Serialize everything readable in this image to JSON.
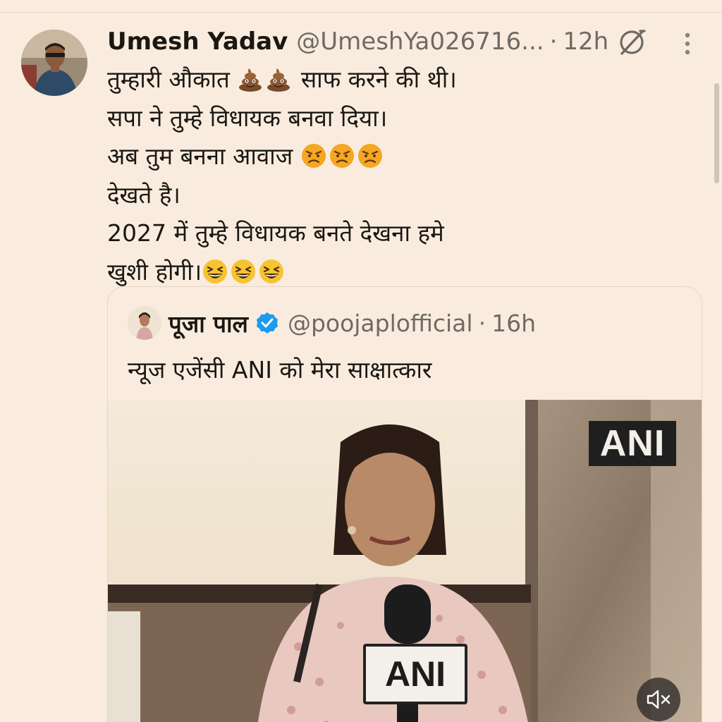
{
  "post": {
    "author_name": "Umesh Yadav",
    "author_handle": "@UmeshYa026716...",
    "separator": "·",
    "time": "12h",
    "lines": [
      {
        "text": "तुम्हारी औकात ",
        "emoji_before": [],
        "emoji_after": [
          "pile-of-poo",
          "pile-of-poo"
        ],
        "suffix": " साफ करने की थी।"
      },
      {
        "text": "सपा ने तुम्हे विधायक बनवा दिया।",
        "emoji_after": [],
        "suffix": ""
      },
      {
        "text": "अब तुम बनना आवाज ",
        "emoji_after": [
          "angry-face",
          "angry-face",
          "angry-face"
        ],
        "suffix": ""
      },
      {
        "text": "देखते है।",
        "emoji_after": [],
        "suffix": ""
      },
      {
        "text": "2027 में तुम्हे विधायक बनते देखना हमे",
        "emoji_after": [],
        "suffix": ""
      },
      {
        "text": "खुशी होगी।",
        "emoji_after": [
          "grinning-squinting-face",
          "grinning-squinting-face",
          "grinning-squinting-face"
        ],
        "suffix": ""
      }
    ]
  },
  "quote": {
    "author_name": "पूजा पाल",
    "author_handle": "@poojaplofficial",
    "separator": "·",
    "time": "16h",
    "text": "न्यूज एजेंसी ANI को मेरा साक्षात्कार",
    "media": {
      "corner_logo": "ANI",
      "mic_flag": "ANI"
    }
  },
  "icons": {
    "grok": "grok-icon",
    "more": "more-icon",
    "verified": "verified-badge-icon",
    "mute": "volume-muted-icon"
  },
  "colors": {
    "background": "#f9ecdf",
    "text": "#1b1712",
    "secondary_text": "#6f6a64",
    "verified": "#1d9bf0"
  }
}
